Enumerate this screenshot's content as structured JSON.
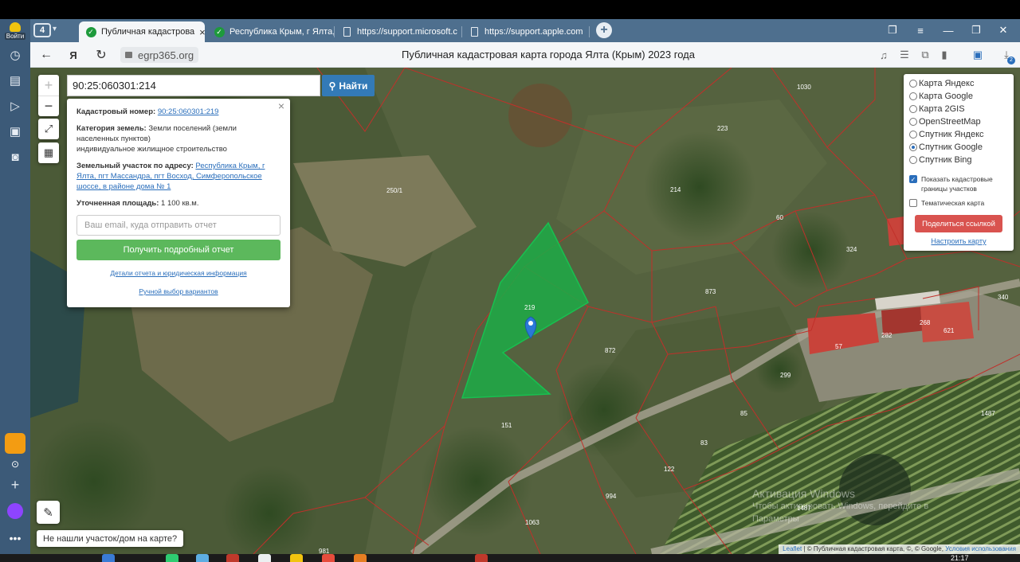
{
  "browser": {
    "tab_count": "4",
    "login_label": "Войти",
    "tabs": [
      {
        "title": "Публичная кадастрова",
        "active": true
      },
      {
        "title": "Республика Крым, г Ялта,",
        "active": false
      },
      {
        "title": "https://support.microsoft.c",
        "active": false
      },
      {
        "title": "https://support.apple.com",
        "active": false
      }
    ],
    "address": "egrp365.org",
    "page_title": "Публичная кадастровая карта города Ялта (Крым) 2023 года",
    "downloads_badge": "2"
  },
  "search": {
    "value": "90:25:060301:214",
    "button_label": "Найти"
  },
  "popup": {
    "cadastral_label": "Кадастровый номер:",
    "cadastral_value": "90:25:060301:219",
    "category_label": "Категория земель:",
    "category_value": "Земли поселений (земли населенных пунктов)",
    "usage": "индивидуальное жилищное строительство",
    "address_label": "Земельный участок по адресу:",
    "address_value": "Республика Крым, г Ялта, пгт Массандра, пгт Восход, Симферопольское шоссе, в районе дома № 1",
    "area_label": "Уточненная площадь:",
    "area_value": "1 100 кв.м.",
    "email_placeholder": "Ваш email, куда отправить отчет",
    "report_button": "Получить подробный отчет",
    "details_link": "Детали отчета и юридическая информация",
    "manual_link": "Ручной выбор вариантов"
  },
  "layers": {
    "options": [
      {
        "label": "Карта Яндекс",
        "selected": false
      },
      {
        "label": "Карта Google",
        "selected": false
      },
      {
        "label": "Карта 2GIS",
        "selected": false
      },
      {
        "label": "OpenStreetMap",
        "selected": false
      },
      {
        "label": "Спутник Яндекс",
        "selected": false
      },
      {
        "label": "Спутник Google",
        "selected": true
      },
      {
        "label": "Спутник Bing",
        "selected": false
      }
    ],
    "show_boundaries_label": "Показать кадастровые границы участков",
    "show_boundaries_checked": true,
    "thematic_label": "Тематическая карта",
    "thematic_checked": false,
    "share_button": "Поделиться ссылкой",
    "settings_link": "Настроить карту"
  },
  "map": {
    "not_found_label": "Не нашли участок/дом на карте?",
    "selected_parcel": "219",
    "parcel_labels": [
      "1030",
      "223",
      "250/1",
      "214",
      "60",
      "324",
      "873",
      "340",
      "872",
      "57",
      "282",
      "268",
      "621",
      "299",
      "85",
      "1487",
      "151",
      "83",
      "122",
      "994",
      "1063",
      "981",
      "1487"
    ],
    "attribution_leaflet": "Leaflet",
    "attribution_text": "| © Публичная кадастровая карта, ©, © Google,",
    "attribution_terms": "Условия использования"
  },
  "watermark": {
    "line1": "Активация Windows",
    "line2": "Чтобы активировать Windows, перейдите в",
    "line3": "Параметры"
  },
  "taskbar": {
    "clock": "21:17"
  },
  "colors": {
    "tabbar": "#4e6f8e",
    "rail": "#3c5a78",
    "selected_parcel": "#1fa847",
    "boundary": "#c0302a",
    "search_button": "#337ab7",
    "report_button": "#5cb85c",
    "share_button": "#d9534f"
  }
}
